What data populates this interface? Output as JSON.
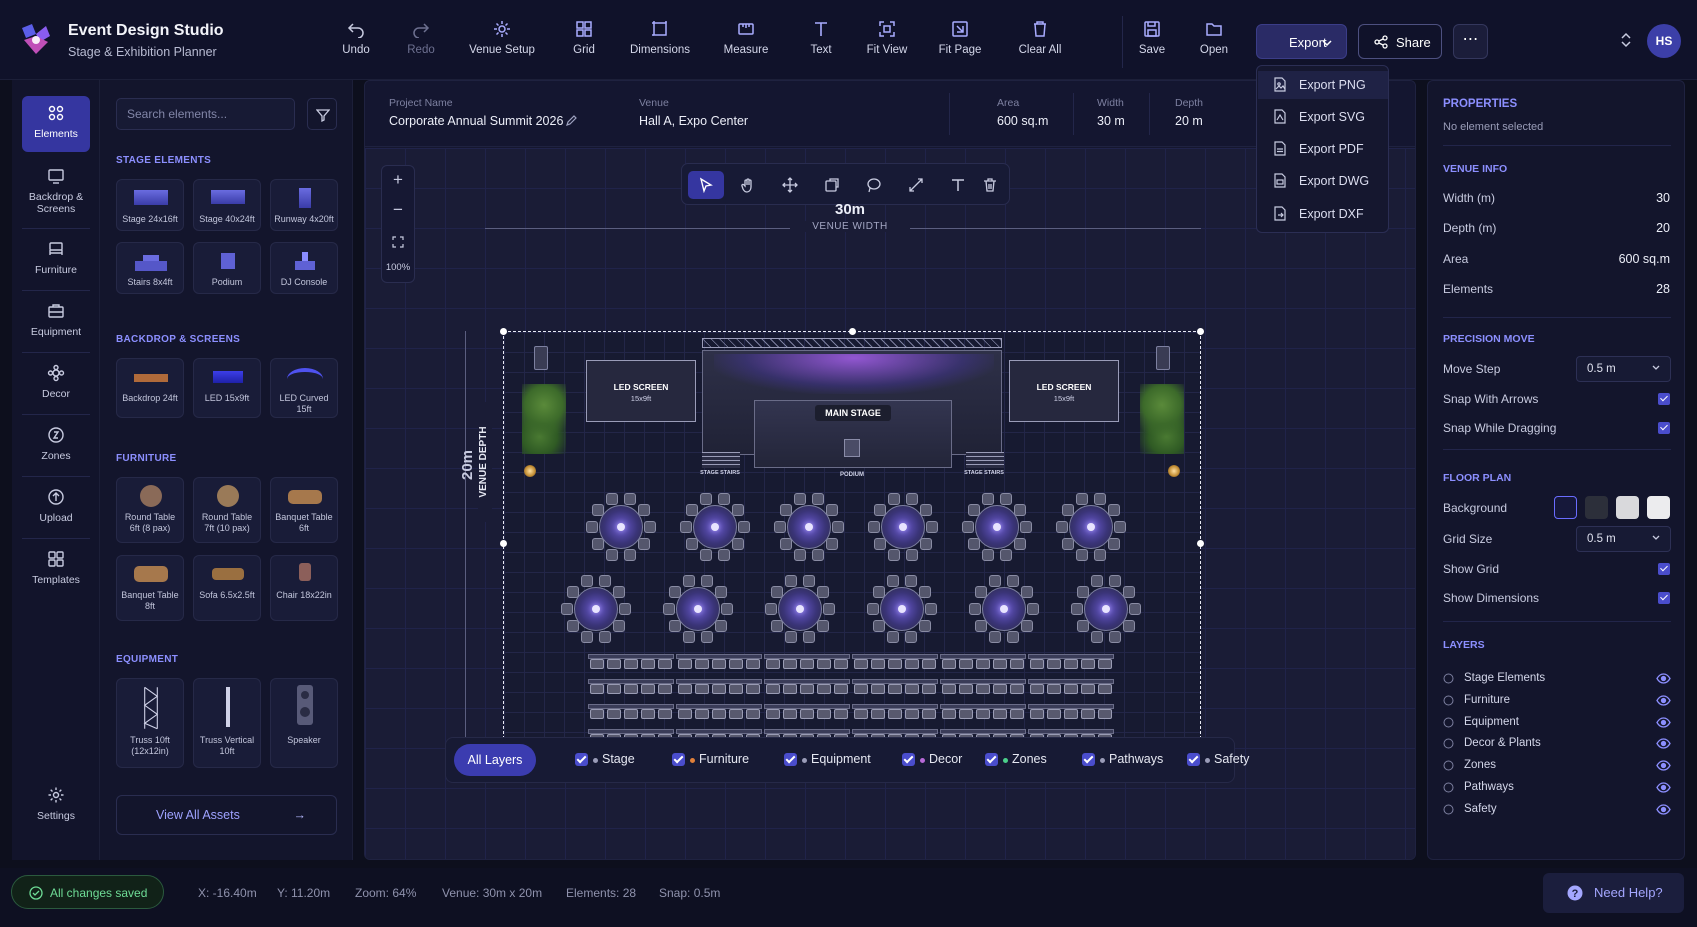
{
  "app": {
    "title": "Event Design Studio",
    "subtitle": "Stage & Exhibition Planner",
    "avatar": "HS"
  },
  "toolbar": {
    "items": [
      {
        "label": "Undo",
        "icon": "undo-icon"
      },
      {
        "label": "Redo",
        "icon": "redo-icon"
      },
      {
        "label": "Venue Setup",
        "icon": "venue-setup-icon"
      },
      {
        "label": "Grid",
        "icon": "grid-icon"
      },
      {
        "label": "Dimensions",
        "icon": "dimensions-icon"
      },
      {
        "label": "Measure",
        "icon": "measure-icon"
      },
      {
        "label": "Text",
        "icon": "text-icon"
      },
      {
        "label": "Fit View",
        "icon": "fit-view-icon"
      },
      {
        "label": "Fit Page",
        "icon": "fit-page-icon"
      },
      {
        "label": "Clear All",
        "icon": "clear-all-icon"
      },
      {
        "label": "Save",
        "icon": "save-icon"
      },
      {
        "label": "Open",
        "icon": "open-folder-icon"
      }
    ],
    "export_label": "Export",
    "share_label": "Share",
    "more_label": "⋯"
  },
  "export_menu": {
    "items": [
      "Export PNG",
      "Export SVG",
      "Export PDF",
      "Export DWG",
      "Export DXF"
    ]
  },
  "rail": {
    "items": [
      {
        "label": "Elements",
        "icon": "elements-icon"
      },
      {
        "label": "Backdrop & Screens",
        "icon": "backdrop-icon"
      },
      {
        "label": "Furniture",
        "icon": "furniture-icon"
      },
      {
        "label": "Equipment",
        "icon": "equipment-icon"
      },
      {
        "label": "Decor",
        "icon": "decor-icon"
      },
      {
        "label": "Zones",
        "icon": "zones-icon"
      },
      {
        "label": "Upload",
        "icon": "upload-icon"
      },
      {
        "label": "Templates",
        "icon": "templates-icon"
      }
    ],
    "settings_label": "Settings"
  },
  "assets": {
    "search_placeholder": "Search elements...",
    "sections": [
      {
        "title": "STAGE ELEMENTS",
        "items": [
          "Stage 24x16ft",
          "Stage 40x24ft",
          "Runway 4x20ft",
          "Stairs 8x4ft",
          "Podium",
          "DJ Console"
        ]
      },
      {
        "title": "BACKDROP & SCREENS",
        "items": [
          "Backdrop 24ft",
          "LED 15x9ft",
          "LED Curved 15ft"
        ]
      },
      {
        "title": "FURNITURE",
        "items": [
          "Round Table 6ft (8 pax)",
          "Round Table 7ft (10 pax)",
          "Banquet Table 6ft",
          "Banquet Table 8ft",
          "Sofa 6.5x2.5ft",
          "Chair 18x22in"
        ]
      },
      {
        "title": "EQUIPMENT",
        "items": [
          "Truss 10ft (12x12in)",
          "Truss Vertical 10ft",
          "Speaker"
        ]
      }
    ],
    "view_all_label": "View All Assets"
  },
  "project": {
    "name_label": "Project Name",
    "name": "Corporate Annual Summit 2026",
    "venue_label": "Venue",
    "venue": "Hall A, Expo Center",
    "area_label": "Area",
    "area": "600 sq.m",
    "width_label": "Width",
    "width": "30 m",
    "depth_label": "Depth",
    "depth": "20 m"
  },
  "canvas": {
    "zoom": "100%",
    "width_value": "30m",
    "width_caption": "VENUE WIDTH",
    "depth_value": "20m",
    "depth_caption": "VENUE DEPTH",
    "led_screen_label": "LED SCREEN",
    "led_screen_size": "15x9ft",
    "main_stage_label": "MAIN STAGE",
    "stage_stairs_label": "STAGE STAIRS",
    "podium_label": "PODIUM",
    "round_tables_front": 6,
    "round_tables_back": 6,
    "banquet_rows": 4,
    "banquet_tables_per_row": 6
  },
  "layer_filter": {
    "all_label": "All Layers",
    "items": [
      "Stage",
      "Furniture",
      "Equipment",
      "Decor",
      "Zones",
      "Pathways",
      "Safety"
    ],
    "dot_colors": [
      "#9a9cb8",
      "#e0803a",
      "#9a9cb8",
      "#b86ad8",
      "#4bd08b",
      "#9a9cb8",
      "#9a9cb8"
    ]
  },
  "properties": {
    "title": "PROPERTIES",
    "none_selected": "No element selected",
    "venue_info_title": "VENUE INFO",
    "venue_info": [
      {
        "label": "Width (m)",
        "value": "30"
      },
      {
        "label": "Depth (m)",
        "value": "20"
      },
      {
        "label": "Area",
        "value": "600 sq.m"
      },
      {
        "label": "Elements",
        "value": "28"
      }
    ],
    "precision_title": "PRECISION MOVE",
    "move_step_label": "Move Step",
    "move_step_value": "0.5 m",
    "snap_arrows_label": "Snap With Arrows",
    "snap_dragging_label": "Snap While Dragging",
    "floor_plan_title": "FLOOR PLAN",
    "background_label": "Background",
    "background_swatches": [
      "#16183a",
      "#2c2f3a",
      "#d9d9dc",
      "#ececee"
    ],
    "grid_size_label": "Grid Size",
    "grid_size_value": "0.5 m",
    "show_grid_label": "Show Grid",
    "show_dimensions_label": "Show Dimensions",
    "layers_title": "LAYERS",
    "layers": [
      "Stage Elements",
      "Furniture",
      "Equipment",
      "Decor & Plants",
      "Zones",
      "Pathways",
      "Safety"
    ]
  },
  "status": {
    "saved": "All changes saved",
    "x": "X: -16.40m",
    "y": "Y: 11.20m",
    "zoom": "Zoom: 64%",
    "venue": "Venue: 30m x 20m",
    "elements": "Elements: 28",
    "snap": "Snap: 0.5m",
    "help": "Need Help?"
  },
  "colors": {
    "accent": "#3b3cb0",
    "accent_text": "#8c8fff",
    "saved_green": "#6edc96"
  }
}
